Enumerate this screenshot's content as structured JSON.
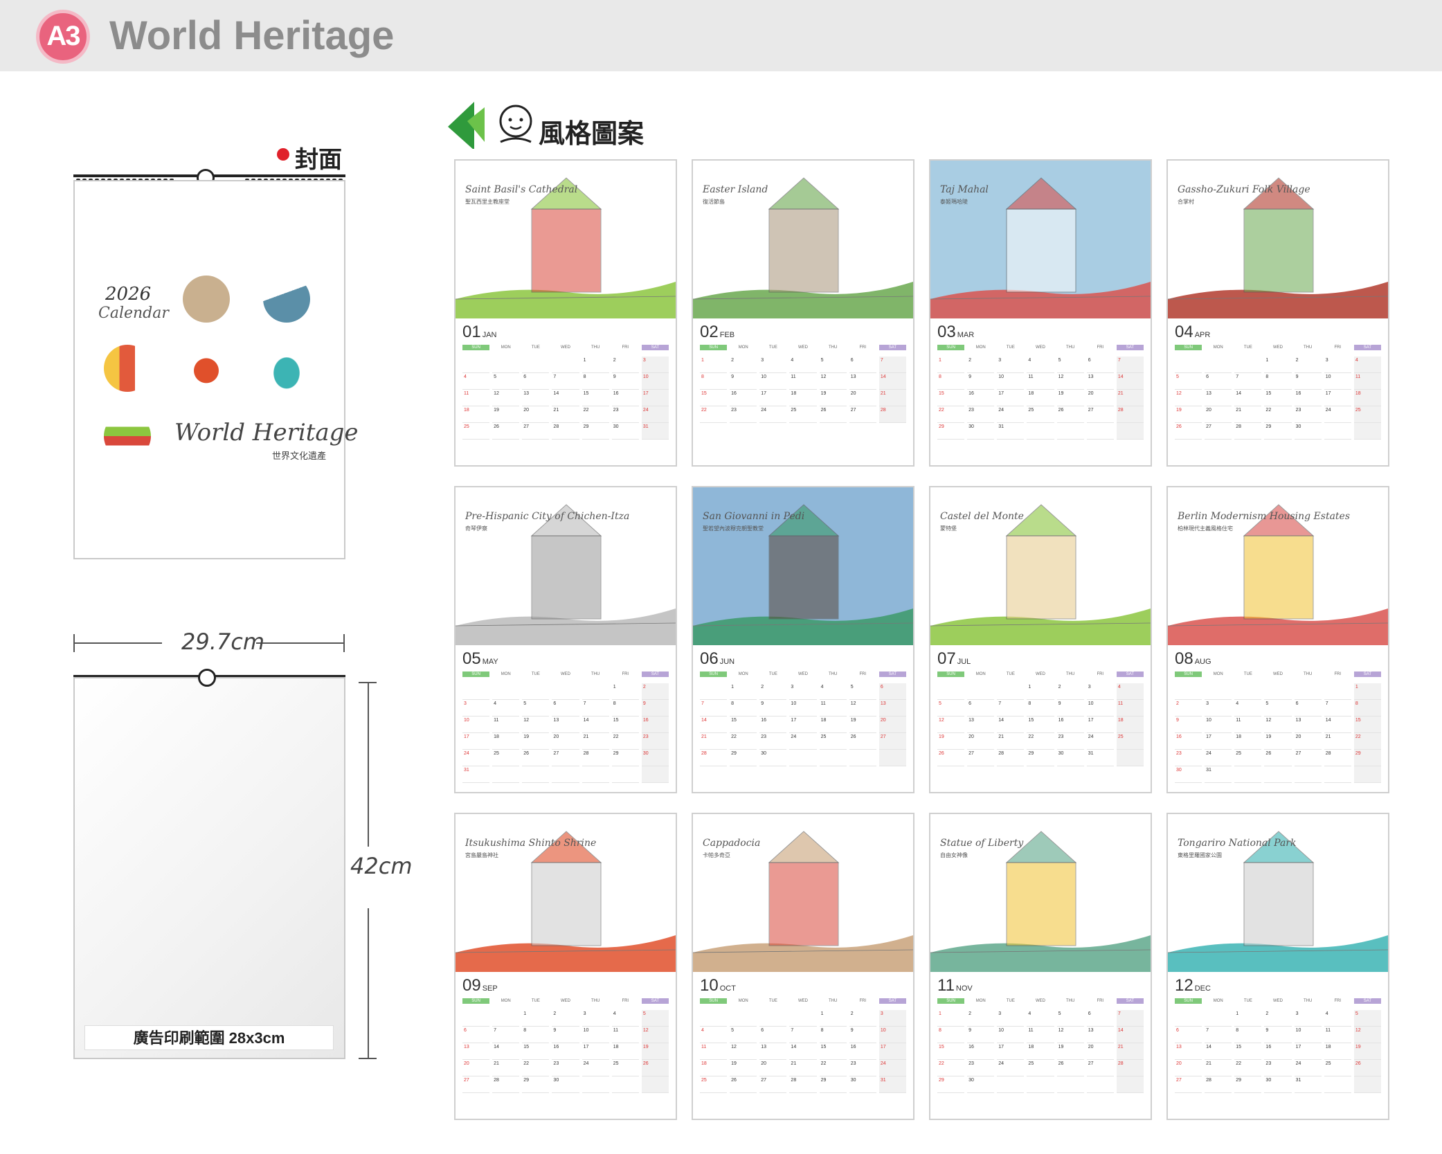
{
  "header": {
    "badge": "A3",
    "title": "World Heritage"
  },
  "cover": {
    "label": "封面",
    "year": "2026",
    "calendar_word": "Calendar",
    "title": "World Heritage",
    "subtitle": "世界文化遺產"
  },
  "dimensions": {
    "width": "29.7cm",
    "height": "42cm"
  },
  "back": {
    "ad_area": "廣告印刷範圍 28x3cm"
  },
  "style_section": {
    "label": "風格圖案"
  },
  "weekdays": [
    "SUN",
    "MON",
    "TUE",
    "WED",
    "THU",
    "FRI",
    "SAT"
  ],
  "months": [
    {
      "num": "01",
      "abbr": "JAN",
      "title": "Saint Basil's Cathedral",
      "subtitle": "聖瓦西里主教座堂",
      "start": 4,
      "days": 31,
      "sky": "#ffffff",
      "ground": "#8cc63f",
      "accent": "#d9483b"
    },
    {
      "num": "02",
      "abbr": "FEB",
      "title": "Easter Island",
      "subtitle": "復活節島",
      "start": 0,
      "days": 28,
      "sky": "#ffffff",
      "ground": "#6aa84f",
      "accent": "#a8957a"
    },
    {
      "num": "03",
      "abbr": "MAR",
      "title": "Taj Mahal",
      "subtitle": "泰姬瑪哈陵",
      "start": 0,
      "days": 31,
      "sky": "#a9cde3",
      "ground": "#d9534f",
      "accent": "#ffffff"
    },
    {
      "num": "04",
      "abbr": "APR",
      "title": "Gassho-Zukuri Folk Village",
      "subtitle": "合掌村",
      "start": 3,
      "days": 30,
      "sky": "#ffffff",
      "ground": "#b23b2e",
      "accent": "#6aa84f"
    },
    {
      "num": "05",
      "abbr": "MAY",
      "title": "Pre-Hispanic City of Chichen-Itza",
      "subtitle": "奇琴伊察",
      "start": 5,
      "days": 31,
      "sky": "#ffffff",
      "ground": "#bbbbbb",
      "accent": "#999999"
    },
    {
      "num": "06",
      "abbr": "JUN",
      "title": "San Giovanni in Pedi",
      "subtitle": "聖若望內波穆克朝聖教堂",
      "start": 1,
      "days": 30,
      "sky": "#8fb7d8",
      "ground": "#3d9a6a",
      "accent": "#5c4a3c"
    },
    {
      "num": "07",
      "abbr": "JUL",
      "title": "Castel del Monte",
      "subtitle": "蒙特堡",
      "start": 3,
      "days": 31,
      "sky": "#ffffff",
      "ground": "#8cc63f",
      "accent": "#e6c98a"
    },
    {
      "num": "08",
      "abbr": "AUG",
      "title": "Berlin Modernism Housing Estates",
      "subtitle": "柏林現代主義風格住宅",
      "start": 6,
      "days": 31,
      "sky": "#ffffff",
      "ground": "#d9534f",
      "accent": "#f1c232"
    },
    {
      "num": "09",
      "abbr": "SEP",
      "title": "Itsukushima Shinto Shrine",
      "subtitle": "宮島嚴島神社",
      "start": 2,
      "days": 30,
      "sky": "#ffffff",
      "ground": "#e0502b",
      "accent": "#cccccc"
    },
    {
      "num": "10",
      "abbr": "OCT",
      "title": "Cappadocia",
      "subtitle": "卡帕多奇亞",
      "start": 4,
      "days": 31,
      "sky": "#ffffff",
      "ground": "#c9a27a",
      "accent": "#d9483b"
    },
    {
      "num": "11",
      "abbr": "NOV",
      "title": "Statue of Liberty",
      "subtitle": "自由女神像",
      "start": 0,
      "days": 30,
      "sky": "#ffffff",
      "ground": "#5fa88c",
      "accent": "#f1c232"
    },
    {
      "num": "12",
      "abbr": "DEC",
      "title": "Tongariro National Park",
      "subtitle": "東格里羅國家公園",
      "start": 2,
      "days": 31,
      "sky": "#ffffff",
      "ground": "#3cb4b4",
      "accent": "#cccccc"
    }
  ]
}
